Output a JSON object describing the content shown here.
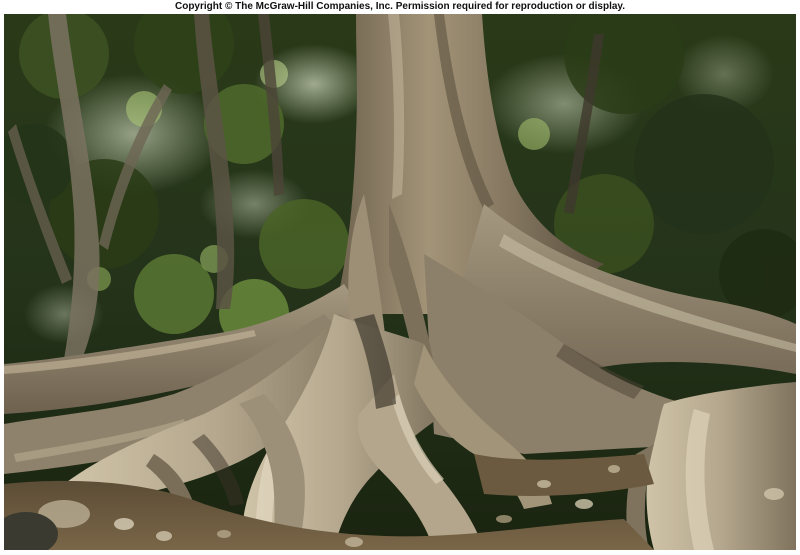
{
  "caption": {
    "copyright_text": "Copyright © The McGraw-Hill Companies, Inc. Permission required for reproduction or display."
  },
  "photo": {
    "colors": {
      "canopy_dark": "#1c2611",
      "canopy_mid": "#3d5223",
      "canopy_light": "#8fae5a",
      "sky": "#dde9c8",
      "bark_light": "#b8ab91",
      "bark_mid": "#8a7c64",
      "bark_dark": "#4c4234",
      "leaf_litter": "#6b5a3f"
    }
  }
}
